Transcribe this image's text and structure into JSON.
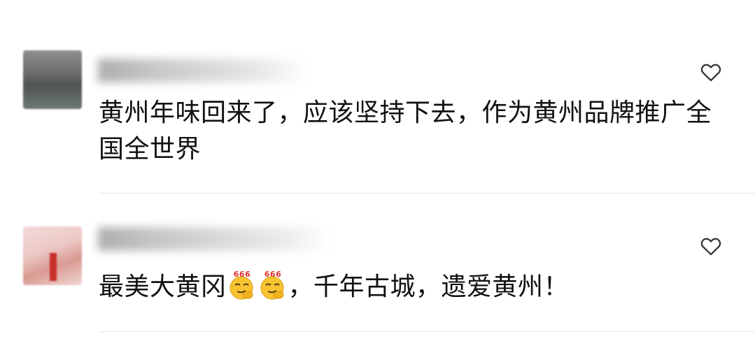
{
  "comments": [
    {
      "text": "黄州年味回来了，应该坚持下去，作为黄州品牌推广全国全世界",
      "avatar_icon": "blurred-avatar",
      "like_icon": "heart-outline-icon"
    },
    {
      "text_before": "最美大黄冈",
      "text_after": "，千年古城，遗爱黄州！",
      "emoji_icon": "666-emoji-icon",
      "emoji_badge": "666",
      "avatar_icon": "blurred-avatar",
      "like_icon": "heart-outline-icon"
    }
  ],
  "colors": {
    "text": "#111111",
    "divider": "#e8e8e8",
    "heart": "#333333",
    "emoji_face": "#f7c331",
    "emoji_badge": "#e0302a"
  }
}
